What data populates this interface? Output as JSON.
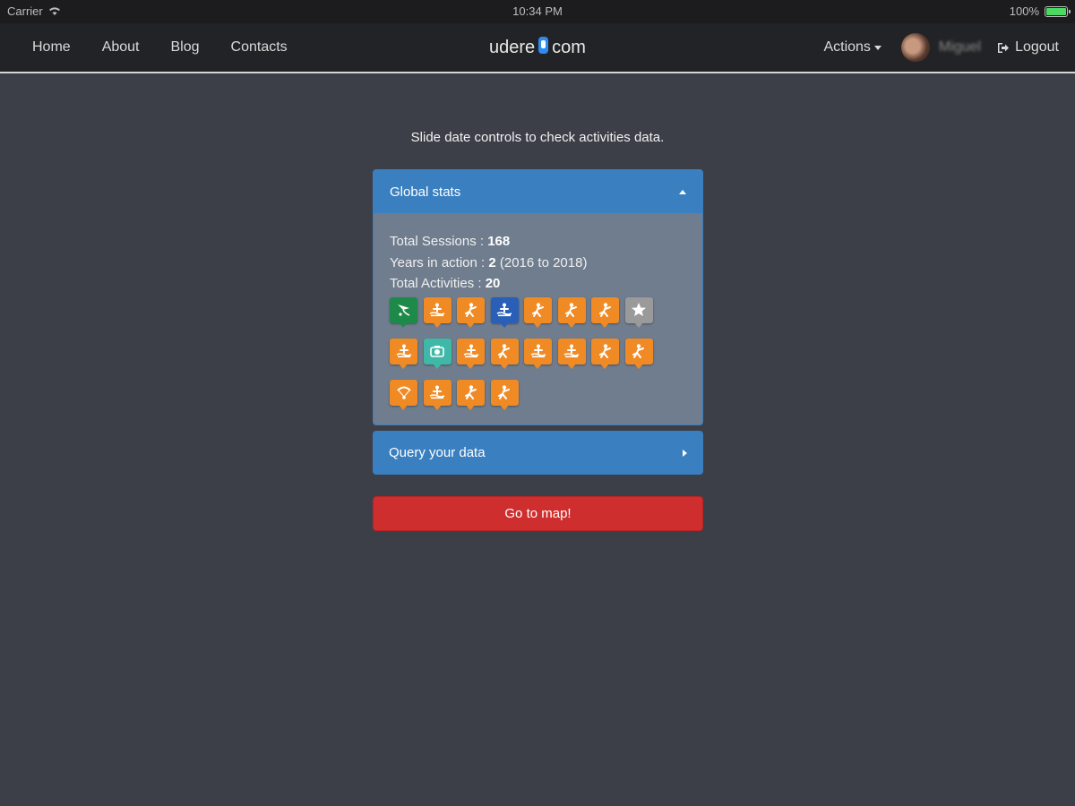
{
  "statusbar": {
    "carrier": "Carrier",
    "time": "10:34 PM",
    "battery": "100%"
  },
  "nav": {
    "links": [
      "Home",
      "About",
      "Blog",
      "Contacts"
    ],
    "brand_left": "udere",
    "brand_right": "com",
    "actions": "Actions",
    "username": "Miguel",
    "logout": "Logout"
  },
  "main": {
    "instruction": "Slide date controls to check activities data.",
    "global_stats": {
      "title": "Global stats",
      "sessions_label": "Total Sessions : ",
      "sessions_value": "168",
      "years_label": "Years in action : ",
      "years_value": "2",
      "years_range": " (2016 to 2018)",
      "activities_label": "Total Activities : ",
      "activities_value": "20"
    },
    "query_panel": {
      "title": "Query your data"
    },
    "map_button": "Go to map!"
  },
  "colors": {
    "orange": "#f08a24",
    "green": "#1e8a4a",
    "blue": "#2a5fb8",
    "gray": "#9a9a9a",
    "teal": "#3fb8a8",
    "panel_blue": "#3a7fc0",
    "button_red": "#cf2e2e"
  },
  "activity_icons": [
    {
      "name": "kite-icon",
      "color": "green"
    },
    {
      "name": "rowing-icon",
      "color": "orange"
    },
    {
      "name": "climbing-icon",
      "color": "orange"
    },
    {
      "name": "fishing-icon",
      "color": "blue"
    },
    {
      "name": "skiing-icon",
      "color": "orange"
    },
    {
      "name": "hiking-icon",
      "color": "orange"
    },
    {
      "name": "yoga-icon",
      "color": "orange"
    },
    {
      "name": "star-icon",
      "color": "gray"
    },
    {
      "name": "paddleboard-icon",
      "color": "orange"
    },
    {
      "name": "camera-icon",
      "color": "teal"
    },
    {
      "name": "kayak-icon",
      "color": "orange"
    },
    {
      "name": "meditation-icon",
      "color": "orange"
    },
    {
      "name": "sailing-icon",
      "color": "orange"
    },
    {
      "name": "diving-icon",
      "color": "orange"
    },
    {
      "name": "running-icon",
      "color": "orange"
    },
    {
      "name": "jumping-icon",
      "color": "orange"
    },
    {
      "name": "paragliding-icon",
      "color": "orange"
    },
    {
      "name": "snorkel-icon",
      "color": "orange"
    },
    {
      "name": "snowboard-icon",
      "color": "orange"
    },
    {
      "name": "stretching-icon",
      "color": "orange"
    }
  ]
}
